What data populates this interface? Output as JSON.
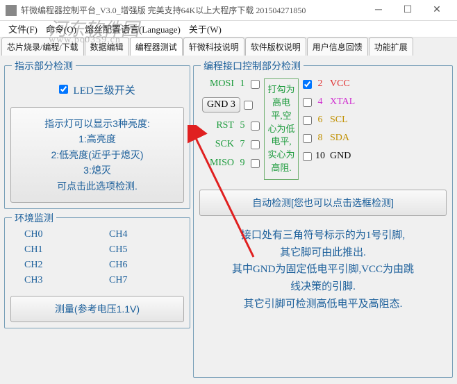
{
  "window": {
    "title": "轩微编程器控制平台_V3.0_增强版 完美支持64K以上大程序下载 201504271850"
  },
  "menu": {
    "file": "文件(F)",
    "cmd": "命令(O)",
    "lang": "熔丝配置语言(Language)",
    "about": "关于(W)"
  },
  "tabs": {
    "t0": "芯片烧录/编程/下载",
    "t1": "数据编辑",
    "t2": "编程器测试",
    "t3": "轩微科技说明",
    "t4": "软件版权说明",
    "t5": "用户信息回馈",
    "t6": "功能扩展"
  },
  "indicator": {
    "legend": "指示部分检测",
    "led_label": "LED三级开关",
    "btn_l1": "指示灯可以显示3种亮度:",
    "btn_l2": "1:高亮度",
    "btn_l3": "2:低亮度(近乎于熄灭)",
    "btn_l4": "3:熄灭",
    "btn_l5": "可点击此选项检测."
  },
  "env": {
    "legend": "环境监测",
    "ch0": "CH0",
    "ch1": "CH1",
    "ch2": "CH2",
    "ch3": "CH3",
    "ch4": "CH4",
    "ch5": "CH5",
    "ch6": "CH6",
    "ch7": "CH7",
    "measure": "测量(参考电压1.1V)"
  },
  "port": {
    "legend": "编程接口控制部分检测",
    "mosi": "MOSI",
    "n1": "1",
    "gnd": "GND 3",
    "rst": "RST",
    "n5": "5",
    "sck": "SCK",
    "n7": "7",
    "miso": "MISO",
    "n9": "9",
    "n2": "2",
    "vcc": " VCC",
    "n4": "4",
    "xtal": " XTAL",
    "n6": "6",
    "scl": " SCL",
    "n8": "8",
    "sda": " SDA",
    "n10": "10",
    "gnd_r": " GND",
    "note": "打勾为高电平,空心为低电平,实心为高阻.",
    "auto": "自动检测[您也可以点击选框检测]",
    "info1": "接口处有三角符号标示的为1号引脚,",
    "info2": "其它脚可由此推出.",
    "info3": "其中GND为固定低电平引脚,VCC为由跳",
    "info4": "线决策的引脚.",
    "info5": "其它引脚可检测高低电平及高阻态."
  },
  "watermark": {
    "w1": "河东软件园",
    "w2": "www.pc0359.cn"
  }
}
